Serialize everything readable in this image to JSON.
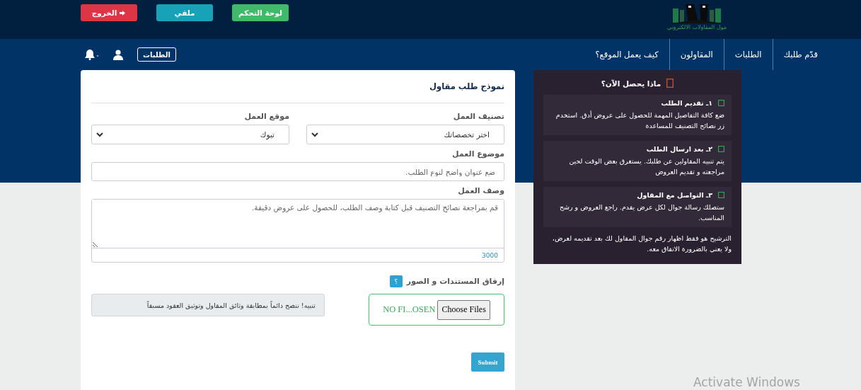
{
  "logo": {
    "caption": "مول المقاولات الالكتروني"
  },
  "top_buttons": [
    {
      "label": "لوحة التحكم",
      "kind": "success"
    },
    {
      "label": "ملفي",
      "kind": "info"
    },
    {
      "label": "الخروج",
      "kind": "danger"
    }
  ],
  "nav": {
    "items": [
      "قدّم طلبك",
      "الطلبات",
      "المقاولون",
      "كيف يعمل الموقع؟"
    ],
    "orders_button": "الطلبات"
  },
  "form": {
    "title": "نموذج طلب مقاول",
    "selects": [
      {
        "label": "تصنيف العمل",
        "value": "اختر تخصصاتك"
      },
      {
        "label": "موقع العمل",
        "value": "تبوك"
      }
    ],
    "subject": {
      "label": "موضوع العمل",
      "placeholder": "ضع عنوان واضح لنوع الطلب."
    },
    "description": {
      "label": "وصف العمل",
      "placeholder": "قم بمراجعة نصائح التصنيف قبل كتابة وصف الطلب، للحصول على عروض دقيقة.",
      "counter": "3000"
    },
    "attachments": {
      "label": "إرفاق المستندات و الصور",
      "help": "؟",
      "button": "Choose Files",
      "status": "NO FI...OSEN"
    },
    "alert": "تنبيه! ننصح دائماً بمطابقة وثائق المقاول وتوثيق العقود مسبقاً",
    "submit": "Submit"
  },
  "panel": {
    "title": "ماذا يحصل الآن؟",
    "steps": [
      {
        "title": "١ـ تقديم الطلب",
        "text": "ضع كافة التفاصيل المهمة للحصول على عروض أدق. استخدم زر نصائح التصنيف للمساعدة"
      },
      {
        "title": "٢ـ بعد ارسال الطلب",
        "text": "يتم تنبيه المقاولين عن طلبك. يستغرق بعض الوقت لحين مراجعته و تقديم العروض"
      },
      {
        "title": "٣ـ التواصل مع المقاول",
        "text": "ستصلك رسالة جوال لكل عرض يقدم. راجع العروض و رشح المناسب."
      }
    ],
    "note": "الترشيح هو فقط اظهار رقم جوال المقاول لك بعد تقديمه لعرض، ولا يعني بالضرورة الاتفاق معه."
  },
  "activation_notice": "Activate Windows"
}
